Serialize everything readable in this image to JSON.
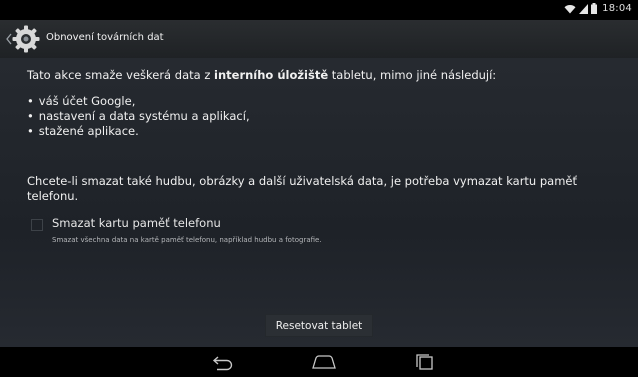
{
  "status_bar": {
    "time": "18:04",
    "icons": [
      "wifi-icon",
      "signal-icon",
      "battery-icon"
    ]
  },
  "action_bar": {
    "title": "Obnovení továrních dat",
    "icon": "gear-icon"
  },
  "content": {
    "intro_before": "Tato akce smaže veškerá data z ",
    "intro_bold": "interního úložiště",
    "intro_after": " tabletu, mimo jiné následují:",
    "bullets": [
      "váš účet Google,",
      "nastavení a data systému a aplikací,",
      "stažené aplikace."
    ],
    "wipe_text": "Chcete-li smazat také hudbu, obrázky a další uživatelská data, je potřeba vymazat kartu paměť telefonu."
  },
  "checkbox": {
    "label": "Smazat kartu paměť telefonu",
    "description": "Smazat všechna data na kartě paměť telefonu, například hudbu a fotografie.",
    "checked": false
  },
  "button": {
    "label": "Resetovat tablet"
  },
  "nav_bar": {
    "icons": [
      "back-icon",
      "home-icon",
      "recent-apps-icon"
    ]
  },
  "colors": {
    "background": "#1e2228",
    "action_bar": "#2a2d30",
    "text": "#f0f0f0"
  }
}
